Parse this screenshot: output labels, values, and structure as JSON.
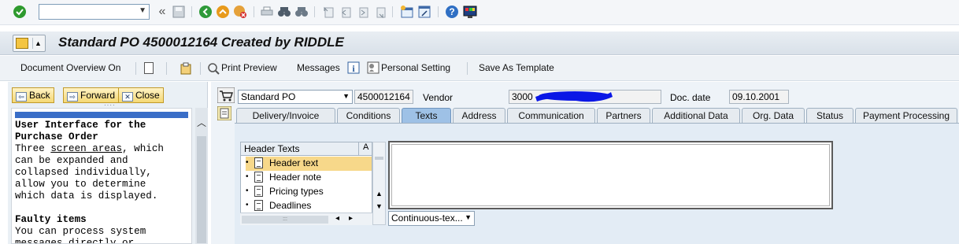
{
  "toolbar": {
    "command_field_value": "",
    "icons": [
      "enter-icon",
      "back-double-arrow-icon",
      "save-icon",
      "back-icon",
      "exit-icon",
      "cancel-icon",
      "print-icon",
      "find-icon",
      "find-next-icon",
      "first-page-icon",
      "previous-page-icon",
      "next-page-icon",
      "last-page-icon",
      "create-session-icon",
      "shortcut-icon",
      "help-icon",
      "customize-layout-icon"
    ]
  },
  "title": "Standard PO 4500012164 Created by RIDDLE",
  "app_toolbar": {
    "document_overview": "Document Overview On",
    "print_preview": "Print Preview",
    "messages": "Messages",
    "personal_setting": "Personal Setting",
    "save_as_template": "Save As Template"
  },
  "navigator": {
    "back": "Back",
    "forward": "Forward",
    "close": "Close",
    "help_lines": [
      {
        "text": "User Interface for the",
        "bold": true
      },
      {
        "text": "Purchase Order",
        "bold": true
      },
      {
        "text": "Three screen areas, which",
        "link": "screen areas"
      },
      {
        "text": "can be expanded and"
      },
      {
        "text": "collapsed individually,"
      },
      {
        "text": "allow you to determine"
      },
      {
        "text": "which data is displayed."
      },
      {
        "text": ""
      },
      {
        "text": "Faulty items",
        "bold": true
      },
      {
        "text": "You can process system"
      },
      {
        "text": "messages directly or"
      }
    ]
  },
  "header": {
    "doc_type": "Standard PO",
    "po_number": "4500012164",
    "vendor_label": "Vendor",
    "vendor_value": "3000",
    "doc_date_label": "Doc. date",
    "doc_date_value": "09.10.2001"
  },
  "tabs": [
    {
      "label": "Delivery/Invoice",
      "active": false
    },
    {
      "label": "Conditions",
      "active": false
    },
    {
      "label": "Texts",
      "active": true
    },
    {
      "label": "Address",
      "active": false
    },
    {
      "label": "Communication",
      "active": false
    },
    {
      "label": "Partners",
      "active": false
    },
    {
      "label": "Additional Data",
      "active": false
    },
    {
      "label": "Org. Data",
      "active": false
    },
    {
      "label": "Status",
      "active": false
    },
    {
      "label": "Payment Processing",
      "active": false
    }
  ],
  "texts_tab": {
    "tree_header": "Header Texts",
    "tree_col2": "A",
    "items": [
      "Header text",
      "Header note",
      "Pricing types",
      "Deadlines"
    ],
    "selected_index": 0,
    "format": "Continuous-tex..."
  },
  "colors": {
    "selection": "#f7d88a",
    "active_tab": "#9ec1e6",
    "redaction": "#0a17e6"
  }
}
